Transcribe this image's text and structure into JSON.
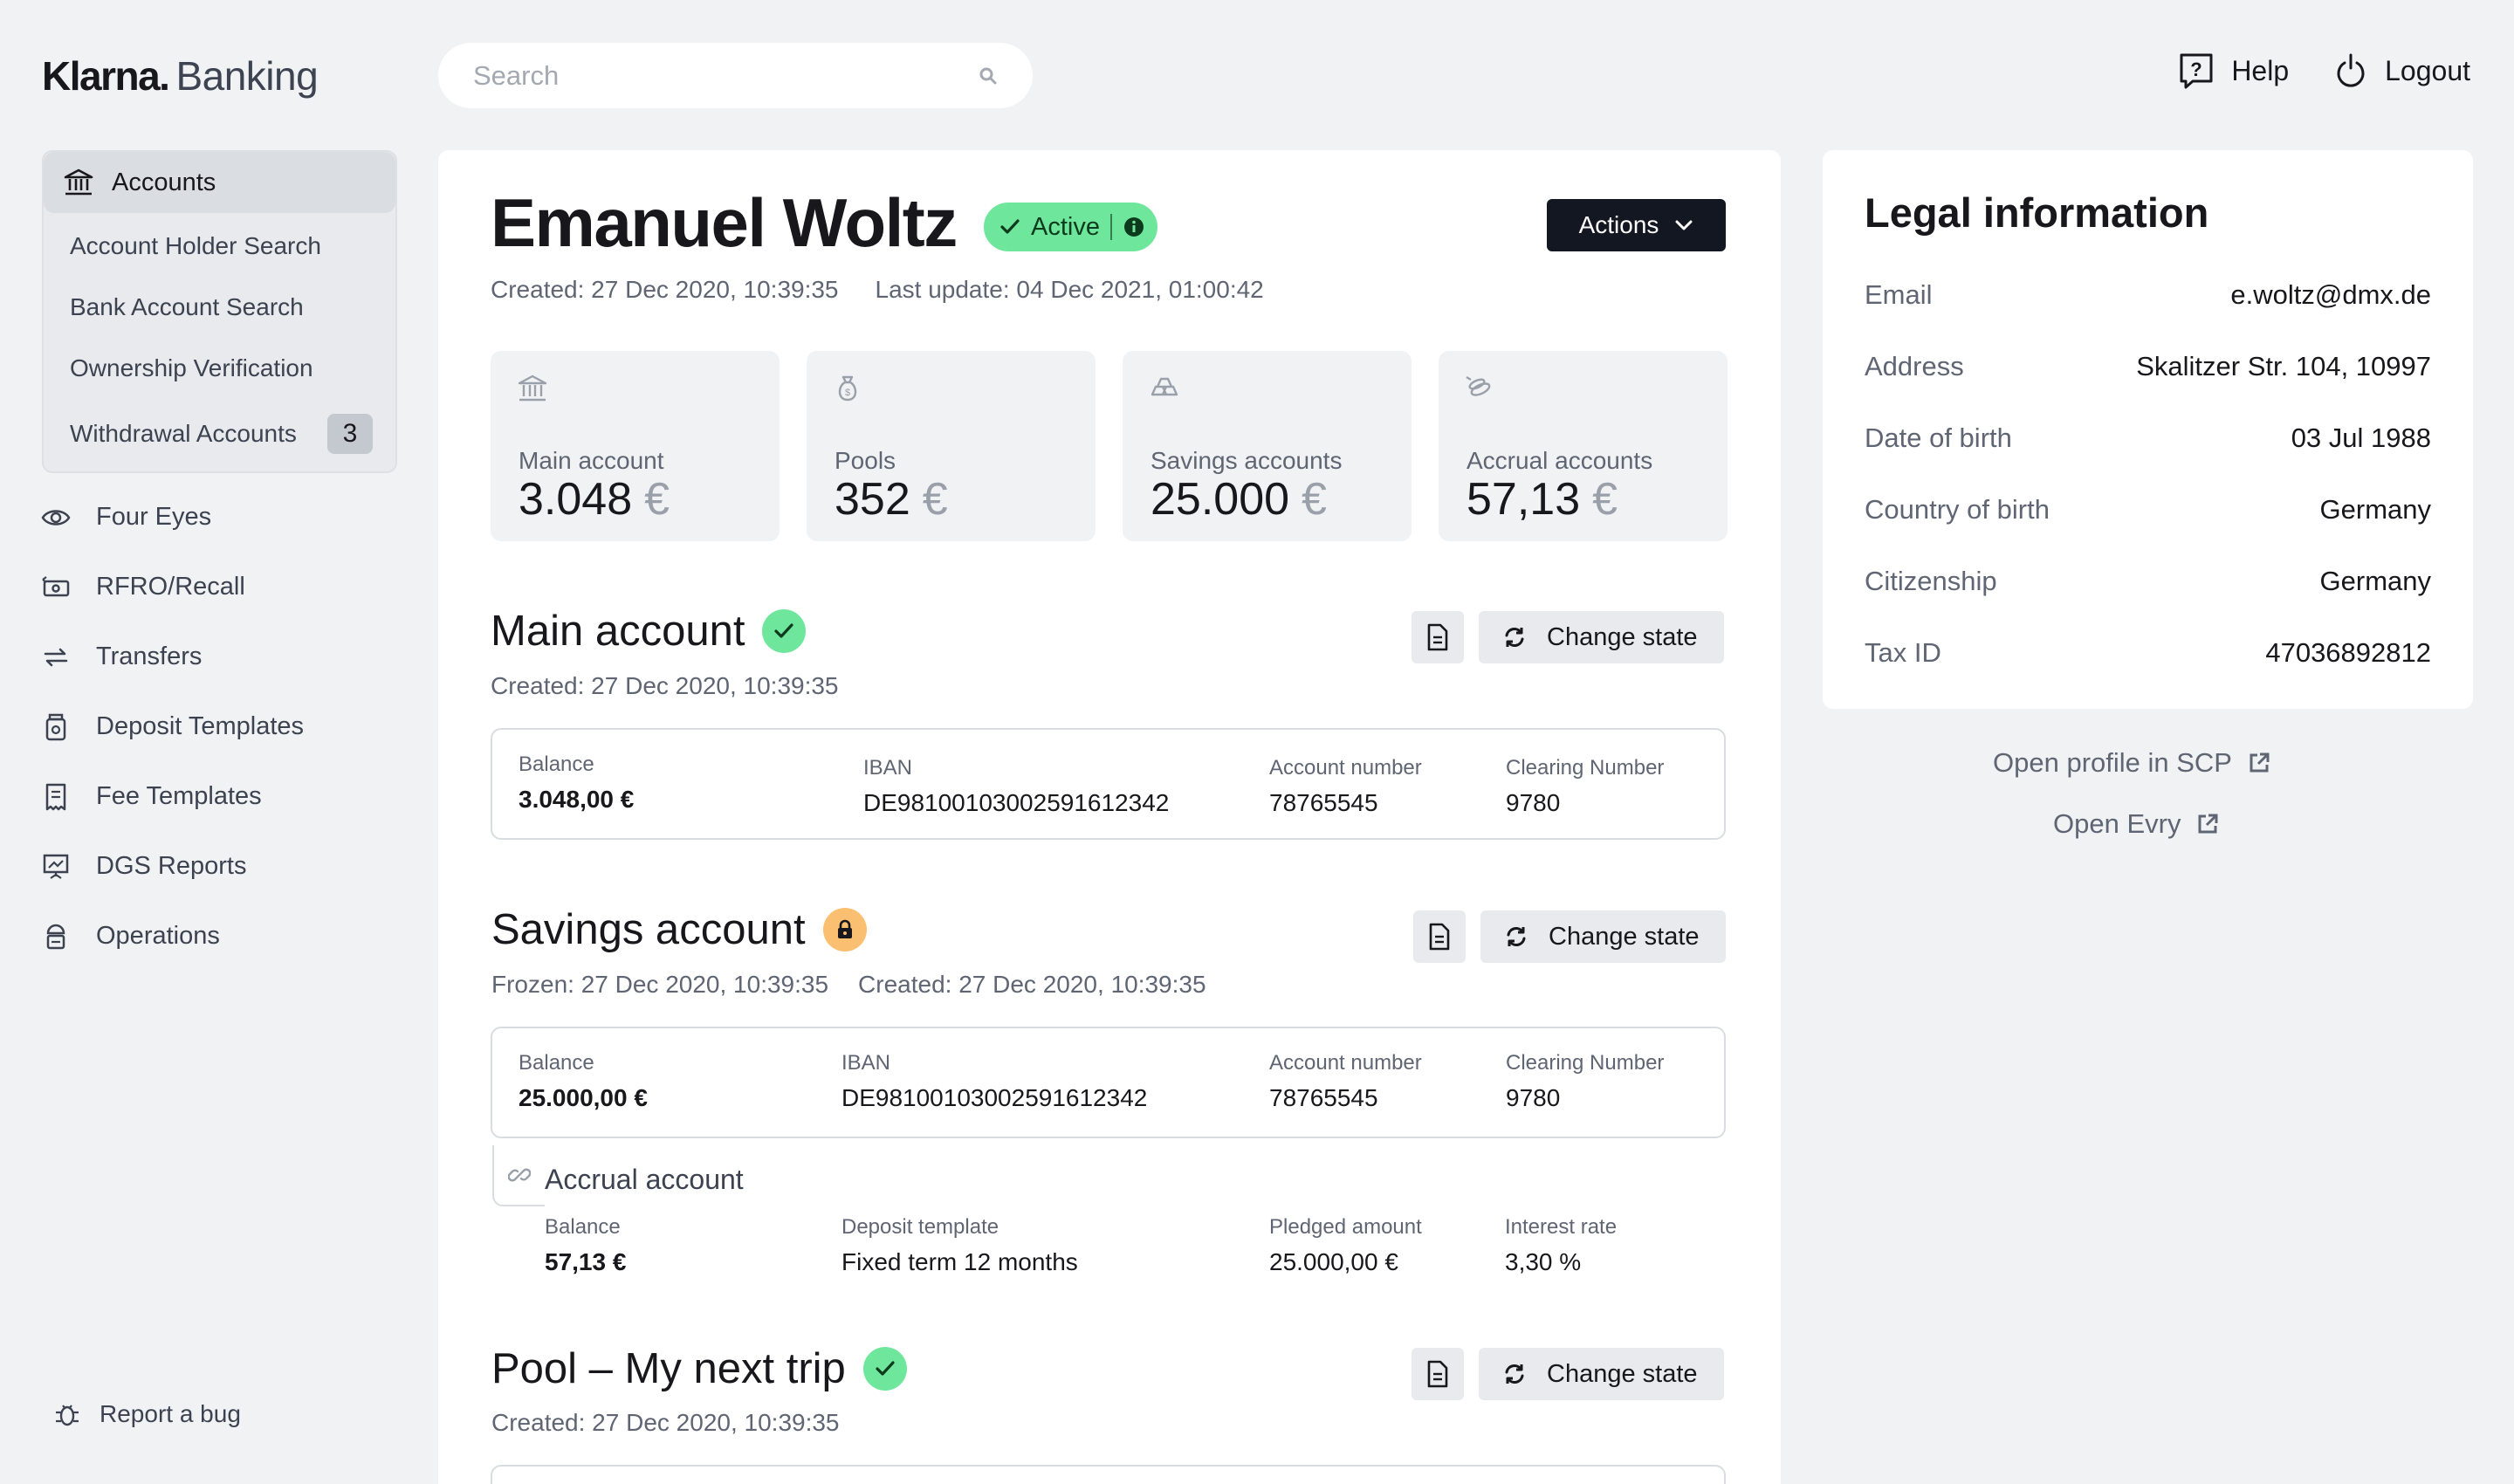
{
  "header": {
    "brand": "Klarna.",
    "product": "Banking",
    "search_placeholder": "Search",
    "help_label": "Help",
    "logout_label": "Logout"
  },
  "sidebar": {
    "accounts_label": "Accounts",
    "accounts_sub": [
      "Account Holder Search",
      "Bank Account Search",
      "Ownership Verification",
      "Withdrawal Accounts"
    ],
    "withdrawal_count": "3",
    "items": [
      "Four Eyes",
      "RFRO/Recall",
      "Transfers",
      "Deposit Templates",
      "Fee Templates",
      "DGS Reports",
      "Operations"
    ],
    "report_bug": "Report a bug"
  },
  "customer": {
    "name": "Emanuel Woltz",
    "status": "Active",
    "actions_label": "Actions",
    "created": "Created: 27 Dec 2020, 10:39:35",
    "last_update": "Last update: 04 Dec 2021, 01:00:42"
  },
  "stats": [
    {
      "label": "Main account",
      "value": "3.048",
      "currency": "€",
      "icon": "bank-icon"
    },
    {
      "label": "Pools",
      "value": "352",
      "currency": "€",
      "icon": "money-bag-icon"
    },
    {
      "label": "Savings accounts",
      "value": "25.000",
      "currency": "€",
      "icon": "gold-bars-icon"
    },
    {
      "label": "Accrual accounts",
      "value": "57,13",
      "currency": "€",
      "icon": "coins-icon"
    }
  ],
  "change_state_label": "Change state",
  "main_account": {
    "title": "Main account",
    "created": "Created: 27 Dec 2020, 10:39:35",
    "balance_label": "Balance",
    "balance": "3.048,00 €",
    "iban_label": "IBAN",
    "iban": "DE98100103002591612342",
    "number_label": "Account number",
    "number": "78765545",
    "clearing_label": "Clearing Number",
    "clearing": "9780"
  },
  "savings_account": {
    "title": "Savings account",
    "frozen": "Frozen: 27 Dec 2020, 10:39:35",
    "created": "Created: 27 Dec 2020, 10:39:35",
    "balance_label": "Balance",
    "balance": "25.000,00 €",
    "iban_label": "IBAN",
    "iban": "DE98100103002591612342",
    "number_label": "Account number",
    "number": "78765545",
    "clearing_label": "Clearing Number",
    "clearing": "9780"
  },
  "accrual": {
    "title": "Accrual account",
    "balance_label": "Balance",
    "balance": "57,13 €",
    "template_label": "Deposit template",
    "template": "Fixed term 12 months",
    "pledged_label": "Pledged amount",
    "pledged": "25.000,00 €",
    "rate_label": "Interest rate",
    "rate": "3,30 %"
  },
  "pool": {
    "title": "Pool – My next trip",
    "created": "Created: 27 Dec 2020, 10:39:35"
  },
  "legal": {
    "title": "Legal information",
    "rows": [
      {
        "k": "Email",
        "v": "e.woltz@dmx.de"
      },
      {
        "k": "Address",
        "v": "Skalitzer Str. 104, 10997"
      },
      {
        "k": "Date of birth",
        "v": "03 Jul 1988"
      },
      {
        "k": "Country of birth",
        "v": "Germany"
      },
      {
        "k": "Citizenship",
        "v": "Germany"
      },
      {
        "k": "Tax ID",
        "v": "47036892812"
      }
    ],
    "open_scp": "Open profile in SCP",
    "open_evry": "Open Evry"
  },
  "colors": {
    "active_badge": "#6ee79d",
    "frozen_badge": "#fbbf72",
    "actions_button": "#131722",
    "background": "#f1f2f4"
  }
}
